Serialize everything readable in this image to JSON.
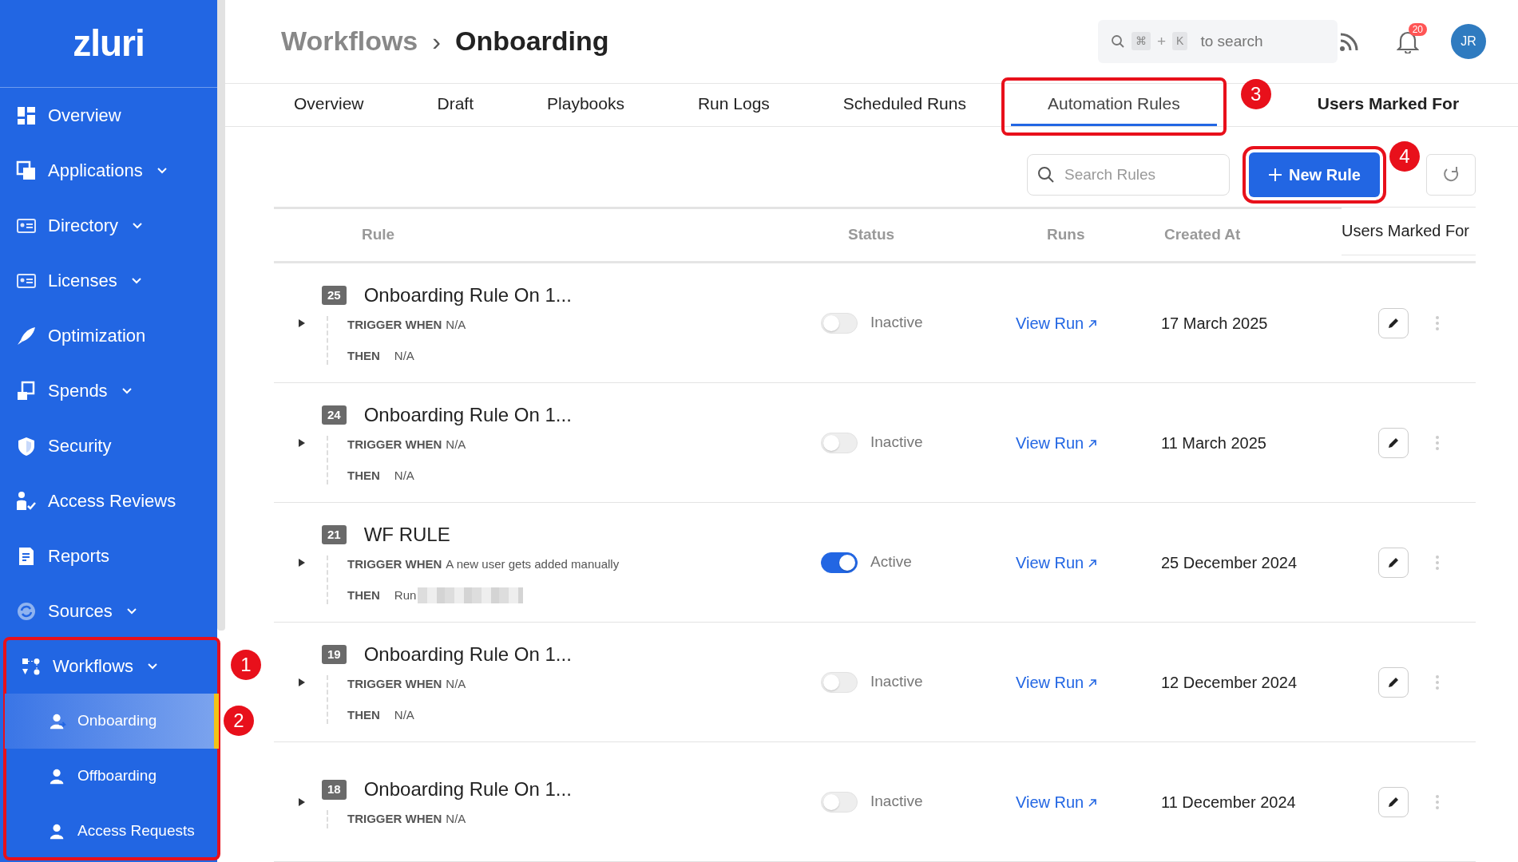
{
  "sidebar": {
    "logo": "zluri",
    "items": [
      {
        "label": "Overview",
        "expandable": false,
        "selected": false
      },
      {
        "label": "Applications",
        "expandable": true,
        "selected": false
      },
      {
        "label": "Directory",
        "expandable": true,
        "selected": false
      },
      {
        "label": "Licenses",
        "expandable": true,
        "selected": false
      },
      {
        "label": "Optimization",
        "expandable": false,
        "selected": false
      },
      {
        "label": "Spends",
        "expandable": true,
        "selected": false
      },
      {
        "label": "Security",
        "expandable": false,
        "selected": false
      },
      {
        "label": "Access Reviews",
        "expandable": false,
        "selected": false
      },
      {
        "label": "Reports",
        "expandable": false,
        "selected": false
      },
      {
        "label": "Sources",
        "expandable": true,
        "selected": false
      },
      {
        "label": "Workflows",
        "expandable": true,
        "selected": false,
        "callout": {
          "number": "1",
          "boxed": true
        },
        "children": [
          {
            "label": "Onboarding",
            "selected": true,
            "callout": {
              "number": "2",
              "boxed": false
            }
          },
          {
            "label": "Offboarding",
            "selected": false
          },
          {
            "label": "Access Requests",
            "selected": false
          }
        ]
      }
    ]
  },
  "header": {
    "breadcrumb": [
      "Workflows",
      "Onboarding"
    ],
    "separator": "›",
    "search": {
      "keys": [
        "⌘",
        "+",
        "K"
      ],
      "placeholder": "to search"
    },
    "notifications": "20",
    "avatar": "JR"
  },
  "tabs": [
    {
      "label": "Overview",
      "selected": false
    },
    {
      "label": "Draft",
      "selected": false
    },
    {
      "label": "Playbooks",
      "selected": false
    },
    {
      "label": "Run Logs",
      "selected": false
    },
    {
      "label": "Scheduled Runs",
      "selected": false
    },
    {
      "label": "Automation Rules",
      "selected": true,
      "callout": {
        "number": "3",
        "boxed": true
      }
    },
    {
      "label": "Users Marked For",
      "selected": false
    }
  ],
  "toolbar": {
    "search": {
      "placeholder": "Search Rules"
    },
    "new_rule_button": {
      "label": "New Rule",
      "callout": {
        "number": "4",
        "boxed": true
      }
    }
  },
  "table": {
    "columns": [
      "Rule",
      "Status",
      "Runs",
      "Created At",
      "Users Marked For"
    ],
    "rows": [
      {
        "id": "25",
        "title": "Onboarding Rule On 1...",
        "trigger_label": "TRIGGER WHEN",
        "trigger": "N/A",
        "then_label": "THEN",
        "then": "N/A",
        "redacted": false,
        "active": false,
        "status": "Inactive",
        "runs": "View Run",
        "created": "17 March 2025"
      },
      {
        "id": "24",
        "title": "Onboarding Rule On 1...",
        "trigger_label": "TRIGGER WHEN",
        "trigger": "N/A",
        "then_label": "THEN",
        "then": "N/A",
        "redacted": false,
        "active": false,
        "status": "Inactive",
        "runs": "View Run",
        "created": "11 March 2025"
      },
      {
        "id": "21",
        "title": "WF RULE",
        "trigger_label": "TRIGGER WHEN",
        "trigger": "A new user gets added manually",
        "then_label": "THEN",
        "then": "Run",
        "redacted": true,
        "active": true,
        "status": "Active",
        "runs": "View Run",
        "created": "25 December 2024"
      },
      {
        "id": "19",
        "title": "Onboarding Rule On 1...",
        "trigger_label": "TRIGGER WHEN",
        "trigger": "N/A",
        "then_label": "THEN",
        "then": "N/A",
        "redacted": false,
        "active": false,
        "status": "Inactive",
        "runs": "View Run",
        "created": "12 December 2024"
      },
      {
        "id": "18",
        "title": "Onboarding Rule On 1...",
        "trigger_label": "TRIGGER WHEN",
        "trigger": "N/A",
        "active": false,
        "status": "Inactive",
        "runs": "View Run",
        "created": "11 December 2024"
      }
    ]
  }
}
